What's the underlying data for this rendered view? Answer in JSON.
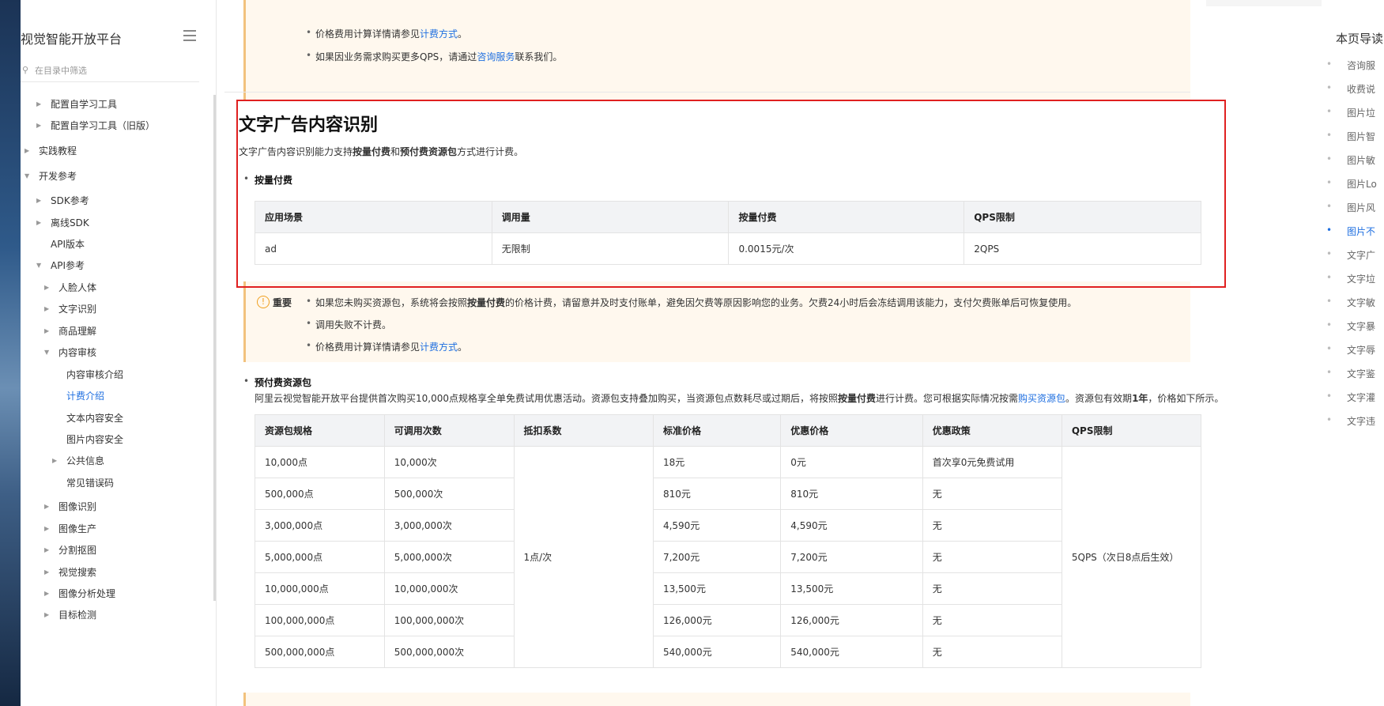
{
  "sidebar": {
    "title": "视觉智能开放平台",
    "filter_placeholder": "在目录中筛选",
    "items": [
      {
        "label": "配置自学习工具"
      },
      {
        "label": "配置自学习工具（旧版）"
      },
      {
        "label": "实践教程"
      },
      {
        "label": "开发参考"
      },
      {
        "label": "SDK参考"
      },
      {
        "label": "离线SDK"
      },
      {
        "label": "API版本"
      },
      {
        "label": "API参考"
      },
      {
        "label": "人脸人体"
      },
      {
        "label": "文字识别"
      },
      {
        "label": "商品理解"
      },
      {
        "label": "内容审核"
      },
      {
        "label": "内容审核介绍"
      },
      {
        "label": "计费介绍"
      },
      {
        "label": "文本内容安全"
      },
      {
        "label": "图片内容安全"
      },
      {
        "label": "公共信息"
      },
      {
        "label": "常见错误码"
      },
      {
        "label": "图像识别"
      },
      {
        "label": "图像生产"
      },
      {
        "label": "分割抠图"
      },
      {
        "label": "视觉搜索"
      },
      {
        "label": "图像分析处理"
      },
      {
        "label": "目标检测"
      }
    ]
  },
  "top_notice": {
    "line1_prefix": "价格费用计算详情请参见",
    "line1_link": "计费方式",
    "line1_suffix": "。",
    "line2_prefix": "如果因业务需求购买更多QPS，请通过",
    "line2_link": "咨询服务",
    "line2_suffix": "联系我们。"
  },
  "section": {
    "title": "文字广告内容识别",
    "desc_a": "文字广告内容识别能力支持",
    "desc_b": "按量付费",
    "desc_c": "和",
    "desc_d": "预付费资源包",
    "desc_e": "方式进行计费。",
    "payg_heading": "按量付费",
    "payg_table": {
      "headers": [
        "应用场景",
        "调用量",
        "按量付费",
        "QPS限制"
      ],
      "rows": [
        [
          "ad",
          "无限制",
          "0.0015元/次",
          "2QPS"
        ]
      ]
    },
    "important": {
      "label": "重要",
      "l1_a": "如果您未购买资源包，系统将会按照",
      "l1_b": "按量付费",
      "l1_c": "的价格计费，请留意并及时支付账单，避免因欠费等原因影响您的业务。欠费24小时后会冻结调用该能力，支付欠费账单后可恢复使用。",
      "l2": "调用失败不计费。",
      "l3_prefix": "价格费用计算详情请参见",
      "l3_link": "计费方式",
      "l3_suffix": "。"
    },
    "prepaid_heading": "预付费资源包",
    "prepaid_para": {
      "a": "阿里云视觉智能开放平台提供首次购买10,000点规格享全单免费试用优惠活动。资源包支持叠加购买，当资源包点数耗尽或过期后，将按照",
      "b": "按量付费",
      "c": "进行计费。您可根据实际情况按需",
      "link": "购买资源包",
      "d": "。资源包有效期",
      "e": "1年",
      "f": "，价格如下所示。"
    },
    "prepaid_table": {
      "headers": [
        "资源包规格",
        "可调用次数",
        "抵扣系数",
        "标准价格",
        "优惠价格",
        "优惠政策",
        "QPS限制"
      ],
      "deduction": "1点/次",
      "qps": "5QPS（次日8点后生效）",
      "rows": [
        [
          "10,000点",
          "10,000次",
          "18元",
          "0元",
          "首次享0元免费试用"
        ],
        [
          "500,000点",
          "500,000次",
          "810元",
          "810元",
          "无"
        ],
        [
          "3,000,000点",
          "3,000,000次",
          "4,590元",
          "4,590元",
          "无"
        ],
        [
          "5,000,000点",
          "5,000,000次",
          "7,200元",
          "7,200元",
          "无"
        ],
        [
          "10,000,000点",
          "10,000,000次",
          "13,500元",
          "13,500元",
          "无"
        ],
        [
          "100,000,000点",
          "100,000,000次",
          "126,000元",
          "126,000元",
          "无"
        ],
        [
          "500,000,000点",
          "500,000,000次",
          "540,000元",
          "540,000元",
          "无"
        ]
      ]
    }
  },
  "toc": {
    "title": "本页导读",
    "items": [
      {
        "label": "咨询服"
      },
      {
        "label": "收费说"
      },
      {
        "label": "图片垃"
      },
      {
        "label": "图片智"
      },
      {
        "label": "图片敏"
      },
      {
        "label": "图片Lo"
      },
      {
        "label": "图片风"
      },
      {
        "label": "图片不"
      },
      {
        "label": "文字广"
      },
      {
        "label": "文字垃"
      },
      {
        "label": "文字敏"
      },
      {
        "label": "文字暴"
      },
      {
        "label": "文字辱"
      },
      {
        "label": "文字鉴"
      },
      {
        "label": "文字灌"
      },
      {
        "label": "文字违"
      }
    ]
  },
  "colors": {
    "link": "#1f6fe0",
    "highlight_box": "#e02020",
    "notice_bg": "#fff8ee"
  }
}
